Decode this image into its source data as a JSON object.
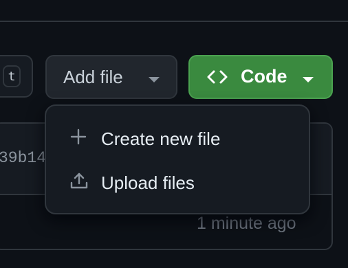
{
  "repo_toolbar": {
    "goto_file_shortcut": "t",
    "add_file": {
      "label": "Add file",
      "icon": "chevron-down-icon"
    },
    "code": {
      "label": "Code",
      "icon": "code-icon",
      "color": "#3a8a3f"
    }
  },
  "add_file_menu": {
    "items": [
      {
        "label": "Create new file",
        "icon": "plus-icon"
      },
      {
        "label": "Upload files",
        "icon": "upload-icon"
      }
    ]
  },
  "latest_commit": {
    "hash_fragment": "39b14",
    "time": "1 minute ago"
  },
  "colors": {
    "page_bg": "#0d1117",
    "surface": "#161b22",
    "border": "#30363d",
    "button_bg": "#21262d",
    "primary_green": "#3a8a3f"
  }
}
